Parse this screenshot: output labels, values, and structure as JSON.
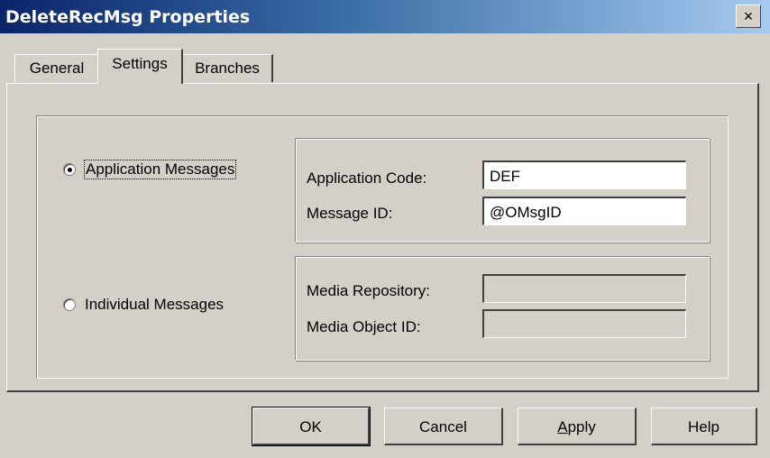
{
  "window": {
    "title": "DeleteRecMsg Properties",
    "close_label": "×"
  },
  "tabs": [
    {
      "label": "General"
    },
    {
      "label": "Settings",
      "active": true
    },
    {
      "label": "Branches"
    }
  ],
  "options": {
    "application_messages": {
      "label": "Application Messages",
      "selected": true
    },
    "individual_messages": {
      "label": "Individual Messages",
      "selected": false
    }
  },
  "application_group": {
    "application_code_label": "Application Code:",
    "application_code_value": "DEF",
    "message_id_label": "Message ID:",
    "message_id_value": "@OMsgID"
  },
  "media_group": {
    "media_repository_label": "Media Repository:",
    "media_repository_value": "",
    "media_object_id_label": "Media Object ID:",
    "media_object_id_value": ""
  },
  "buttons": {
    "ok": "OK",
    "cancel": "Cancel",
    "apply_first": "A",
    "apply_rest": "pply",
    "help": "Help"
  }
}
